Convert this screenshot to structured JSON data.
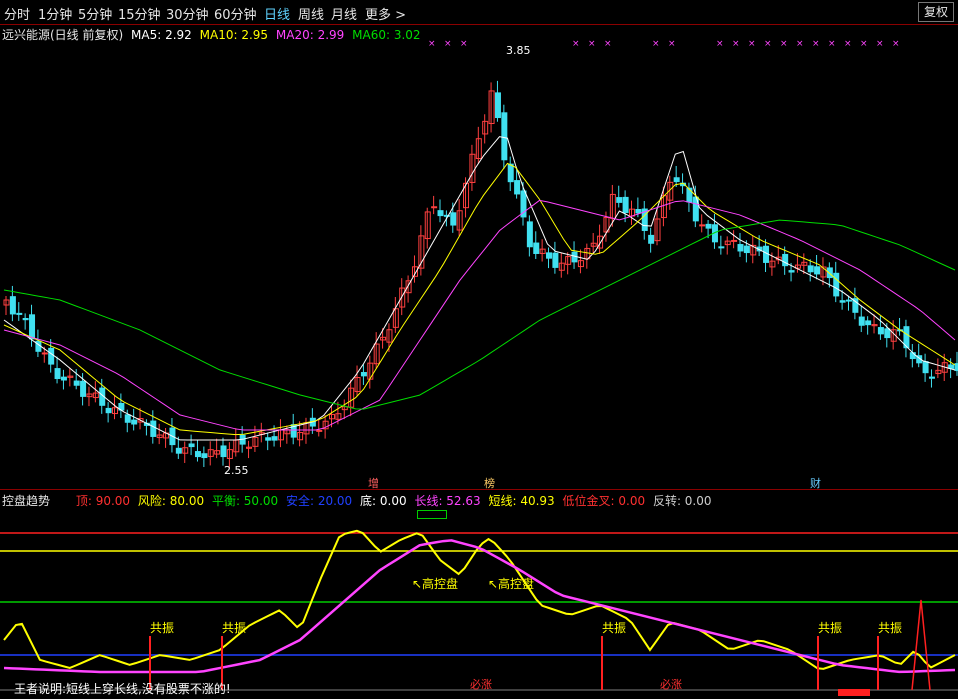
{
  "toolbar": {
    "periods": [
      "分时",
      "1分钟",
      "5分钟",
      "15分钟",
      "30分钟",
      "60分钟",
      "日线",
      "周线",
      "月线",
      "更多 >"
    ],
    "active": "日线",
    "restore_label": "复权"
  },
  "main_legend": {
    "stock": "远兴能源(日线 前复权)",
    "ma5": "MA5: 2.92",
    "ma10": "MA10: 2.95",
    "ma20": "MA20: 2.99",
    "ma60": "MA60: 3.02",
    "colors": {
      "ma5": "#ffffff",
      "ma10": "#ffff00",
      "ma20": "#ff44ff",
      "ma60": "#00dd00"
    }
  },
  "price_labels": {
    "high": "3.85",
    "low": "2.55"
  },
  "event_badges": [
    "增",
    "榜",
    "财"
  ],
  "indicator_legend": {
    "name": "控盘趋势",
    "items": [
      {
        "text": "顶: 90.00",
        "color": "#ff3030"
      },
      {
        "text": "风险: 80.00",
        "color": "#ffff00"
      },
      {
        "text": "平衡: 50.00",
        "color": "#00dd00"
      },
      {
        "text": "安全: 20.00",
        "color": "#2040ff"
      },
      {
        "text": "底: 0.00",
        "color": "#ffffff"
      },
      {
        "text": "长线: 52.63",
        "color": "#ff44ff"
      },
      {
        "text": "短线: 40.93",
        "color": "#ffff00"
      },
      {
        "text": "低位金叉: 0.00",
        "color": "#ff3030"
      },
      {
        "text": "反转: 0.00",
        "color": "#cccccc"
      }
    ]
  },
  "indicator_annotations": {
    "resonance": "共振",
    "high_control": "高控盘",
    "must_rise": "必涨"
  },
  "notice": "王者说明:短线上穿长线,没有股票不涨的!",
  "chart_data": {
    "type": "candlestick",
    "series_ma": [
      "MA5",
      "MA10",
      "MA20",
      "MA60"
    ],
    "high": 3.85,
    "low": 2.55,
    "indicator": {
      "name": "控盘趋势",
      "levels": {
        "顶": 90,
        "风险": 80,
        "平衡": 50,
        "安全": 20,
        "底": 0
      },
      "last": {
        "长线": 52.63,
        "短线": 40.93,
        "低位金叉": 0,
        "反转": 0
      }
    }
  }
}
